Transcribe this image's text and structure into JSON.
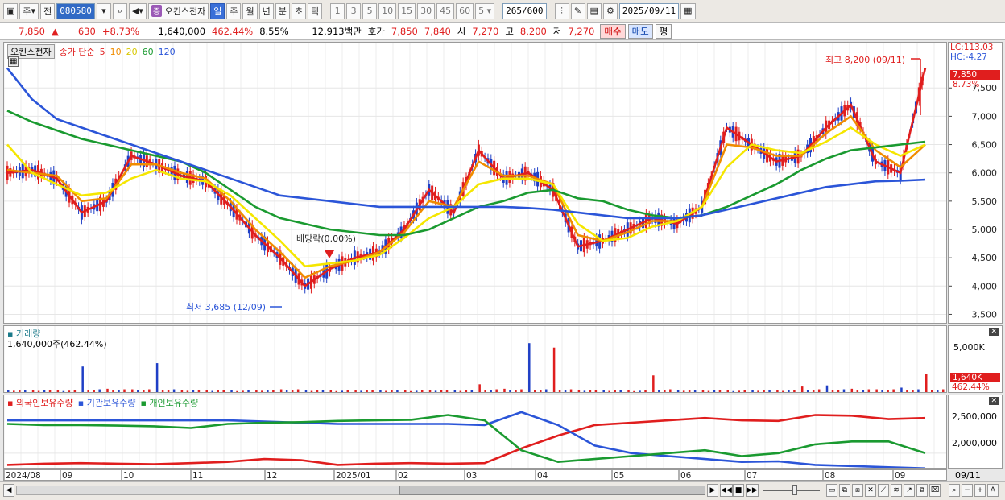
{
  "toolbar": {
    "period": "주",
    "prev": "전",
    "code": "080580",
    "stock_name": "오킨스전자",
    "stock_tag": "증",
    "intervals": [
      "일",
      "주",
      "월",
      "년",
      "분",
      "초",
      "틱"
    ],
    "active_interval": "일",
    "multipliers": [
      "1",
      "3",
      "5",
      "10",
      "15",
      "30",
      "45",
      "60"
    ],
    "count_select": "5",
    "range_value": "265",
    "range_total": "/600",
    "date": "2025/09/11"
  },
  "quote": {
    "price": "7,850",
    "arrow": "▲",
    "change": "630",
    "change_pct": "+8.73%",
    "volume": "1,640,000",
    "volume_pct": "462.44%",
    "turnover": "8.55%",
    "amount": "12,913백만",
    "bid_label": "호가",
    "bid1": "7,850",
    "bid2": "7,840",
    "open_label": "시",
    "open": "7,270",
    "high_label": "고",
    "high": "8,200",
    "low_label": "저",
    "low": "7,270",
    "buy": "매수",
    "sell": "매도",
    "eval": "평"
  },
  "price_chart": {
    "name_chip": "오킨스전자",
    "legend_label": "종가 단순",
    "ma_periods": [
      "5",
      "10",
      "20",
      "60",
      "120"
    ],
    "ma_colors": [
      "#e01e1e",
      "#f08c00",
      "#f5e600",
      "#1a9a30",
      "#2b55d8"
    ],
    "high_annotation": "최고 8,200 (09/11)",
    "low_annotation": "최저 3,685 (12/09)",
    "dividend_annotation": "배당락(0.00%)",
    "lc": "LC:113.03",
    "hc": "HC:-4.27",
    "current_price": "7,850",
    "current_pct": "8.73%",
    "y_ticks": [
      "7,500",
      "7,000",
      "6,500",
      "6,000",
      "5,500",
      "5,000",
      "4,500",
      "4,000",
      "3,500"
    ]
  },
  "volume_chart": {
    "title": "거래량",
    "info": "1,640,000주(462.44%)",
    "y_tick": "5,000K",
    "current": "1,640K",
    "current_pct": "462.44%"
  },
  "holdings_chart": {
    "legends": [
      "외국인보유수량",
      "기관보유수량",
      "개인보유수량"
    ],
    "legend_colors": [
      "#e01e1e",
      "#2b55d8",
      "#1a9a30"
    ],
    "y_ticks": [
      "2,500,000",
      "2,000,000"
    ]
  },
  "x_axis": [
    "2024/08",
    "09",
    "10",
    "11",
    "12",
    "2025/01",
    "02",
    "03",
    "04",
    "05",
    "06",
    "07",
    "08",
    "09"
  ],
  "x_axis_right": "09/11",
  "chart_data": {
    "type": "line",
    "title": "",
    "xlabel": "",
    "ylabel": "",
    "ylim": [
      3350,
      8300
    ],
    "period": "2024/08 - 2025/09/11",
    "series": [
      {
        "name": "5",
        "values": [
          6000,
          6050,
          5900,
          5300,
          5500,
          6300,
          6150,
          5950,
          5850,
          5400,
          4900,
          4500,
          4000,
          4300,
          4500,
          4600,
          5000,
          5700,
          5300,
          6400,
          5900,
          6000,
          5700,
          4700,
          4800,
          5000,
          5200,
          5100,
          5400,
          6800,
          6500,
          6200,
          6300,
          6800,
          7200,
          6200,
          6000,
          7850
        ]
      },
      {
        "name": "10",
        "values": [
          6050,
          6000,
          5950,
          5500,
          5550,
          6150,
          6150,
          6000,
          5900,
          5500,
          5000,
          4600,
          4150,
          4350,
          4450,
          4600,
          4950,
          5500,
          5400,
          6200,
          5950,
          5950,
          5800,
          4900,
          4800,
          4950,
          5150,
          5150,
          5400,
          6500,
          6450,
          6300,
          6300,
          6700,
          7000,
          6400,
          6100,
          6500
        ]
      },
      {
        "name": "20",
        "values": [
          6500,
          6000,
          5800,
          5600,
          5650,
          5900,
          6050,
          5900,
          5850,
          5600,
          5200,
          4800,
          4350,
          4400,
          4450,
          4550,
          4850,
          5200,
          5400,
          5800,
          5900,
          5900,
          5800,
          5100,
          4800,
          4850,
          5050,
          5150,
          5400,
          6100,
          6500,
          6400,
          6350,
          6550,
          6800,
          6500,
          6300,
          6500
        ]
      },
      {
        "name": "60",
        "values": [
          7100,
          6900,
          6750,
          6600,
          6500,
          6400,
          6300,
          6200,
          6000,
          5700,
          5400,
          5200,
          5100,
          5000,
          4950,
          4900,
          4900,
          5000,
          5200,
          5400,
          5500,
          5650,
          5700,
          5550,
          5500,
          5350,
          5250,
          5200,
          5250,
          5400,
          5600,
          5800,
          6050,
          6250,
          6400,
          6450,
          6500,
          6550
        ]
      },
      {
        "name": "120",
        "values": [
          7850,
          7300,
          6950,
          6800,
          6650,
          6500,
          6350,
          6200,
          6050,
          5900,
          5750,
          5600,
          5550,
          5500,
          5450,
          5400,
          5400,
          5400,
          5400,
          5400,
          5400,
          5380,
          5350,
          5300,
          5250,
          5200,
          5200,
          5200,
          5250,
          5350,
          5450,
          5550,
          5650,
          5750,
          5800,
          5850,
          5860,
          5880
        ]
      }
    ],
    "volume_series": {
      "name": "거래량",
      "values": [
        200,
        180,
        160,
        2300,
        300,
        250,
        2600,
        200,
        180,
        150,
        200,
        250,
        180,
        150,
        200,
        180,
        150,
        200,
        180,
        700,
        300,
        4400,
        4000,
        200,
        180,
        150,
        1500,
        200,
        180,
        150,
        200,
        180,
        500,
        600,
        300,
        250,
        400,
        1640
      ],
      "unit": "K"
    },
    "holdings": [
      {
        "name": "외국인보유수량",
        "values": [
          1800000,
          1820000,
          1830000,
          1820000,
          1810000,
          1830000,
          1850000,
          1900000,
          1880000,
          1800000,
          1820000,
          1830000,
          1820000,
          1830000,
          2080000,
          2300000,
          2480000,
          2520000,
          2560000,
          2600000,
          2560000,
          2550000,
          2650000,
          2640000,
          2580000,
          2600000
        ]
      },
      {
        "name": "기관보유수량",
        "values": [
          2560000,
          2560000,
          2560000,
          2560000,
          2560000,
          2560000,
          2560000,
          2540000,
          2520000,
          2500000,
          2500000,
          2500000,
          2500000,
          2480000,
          2700000,
          2480000,
          2130000,
          2000000,
          1950000,
          1900000,
          1850000,
          1860000,
          1800000,
          1780000,
          1760000,
          1740000
        ]
      },
      {
        "name": "개인보유수량",
        "values": [
          2500000,
          2480000,
          2480000,
          2470000,
          2460000,
          2430000,
          2500000,
          2520000,
          2530000,
          2550000,
          2560000,
          2570000,
          2650000,
          2560000,
          2050000,
          1850000,
          1900000,
          1950000,
          2000000,
          2050000,
          1950000,
          2000000,
          2150000,
          2200000,
          2200000,
          2000000
        ]
      }
    ]
  }
}
